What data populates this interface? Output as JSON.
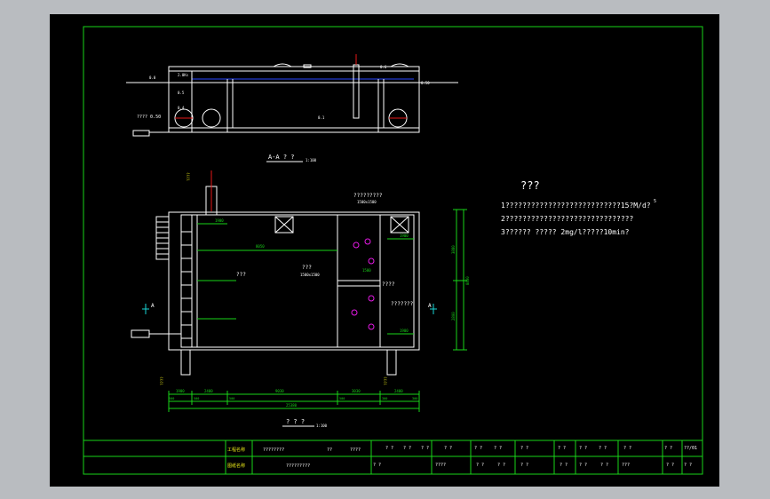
{
  "section_view": {
    "title": "A-A ? ?",
    "scale": "1:100",
    "labels": [
      "2.0Ks",
      "0.5",
      "0.4",
      "???? 0.50",
      "0.1",
      "0.50",
      "0.6"
    ]
  },
  "plan_view": {
    "title": "? ? ?",
    "scale": "1:100",
    "label_top_right": "?????????",
    "label_top_right_sub": "1500x1500",
    "label_center": "???",
    "label_center_sub": "1500x1500",
    "label_left": "???",
    "label_mid_right": "????",
    "label_mid_right2": "???????",
    "label_upper_mid": "????",
    "section_marker": "A",
    "dims_bottom": [
      "1900",
      "2400",
      "9030",
      "3030",
      "2400"
    ],
    "dims_bottom_total": "25380",
    "dims_bottom_ticks": [
      "500",
      "500",
      "500",
      "500",
      "300",
      "300",
      "300"
    ],
    "dims_right": [
      "800",
      "3880",
      "2800"
    ],
    "dims_right_total": "8800",
    "dims_inner": [
      "1900",
      "8050",
      "1900",
      "1900",
      "1500",
      "5880"
    ]
  },
  "notes": {
    "heading": "???",
    "lines": [
      "1???????????????????????????15?M/d?",
      "2??????????????????????????????",
      "3??????   ?????  2mg/l?????10min?"
    ],
    "footnote": "5"
  },
  "title_block": {
    "project_label": "工程名称",
    "project_value": "????????",
    "drawing_label": "图纸名称",
    "drawing_value": "?????????",
    "col_a": "??",
    "col_b": "????",
    "cells_row1": [
      "? ?",
      "? ?",
      "? ?",
      "? ?",
      "? ?",
      "? ?",
      "? ?",
      "? ?",
      "? ?",
      "? ?",
      "? ?",
      "? ?",
      "??/01"
    ],
    "cells_row2": [
      "? ?",
      "????",
      "? ?",
      "? ?",
      "? ?",
      "? ?",
      "? ?",
      "? ?",
      "???",
      "? ?",
      "? ?"
    ]
  },
  "colors": {
    "background": "#000000",
    "frame": "#19d419",
    "lines": "#ffffff",
    "accent_yellow": "#e6e619",
    "accent_red": "#e61919",
    "accent_magenta": "#e619e6",
    "water": "#2a49ff"
  }
}
